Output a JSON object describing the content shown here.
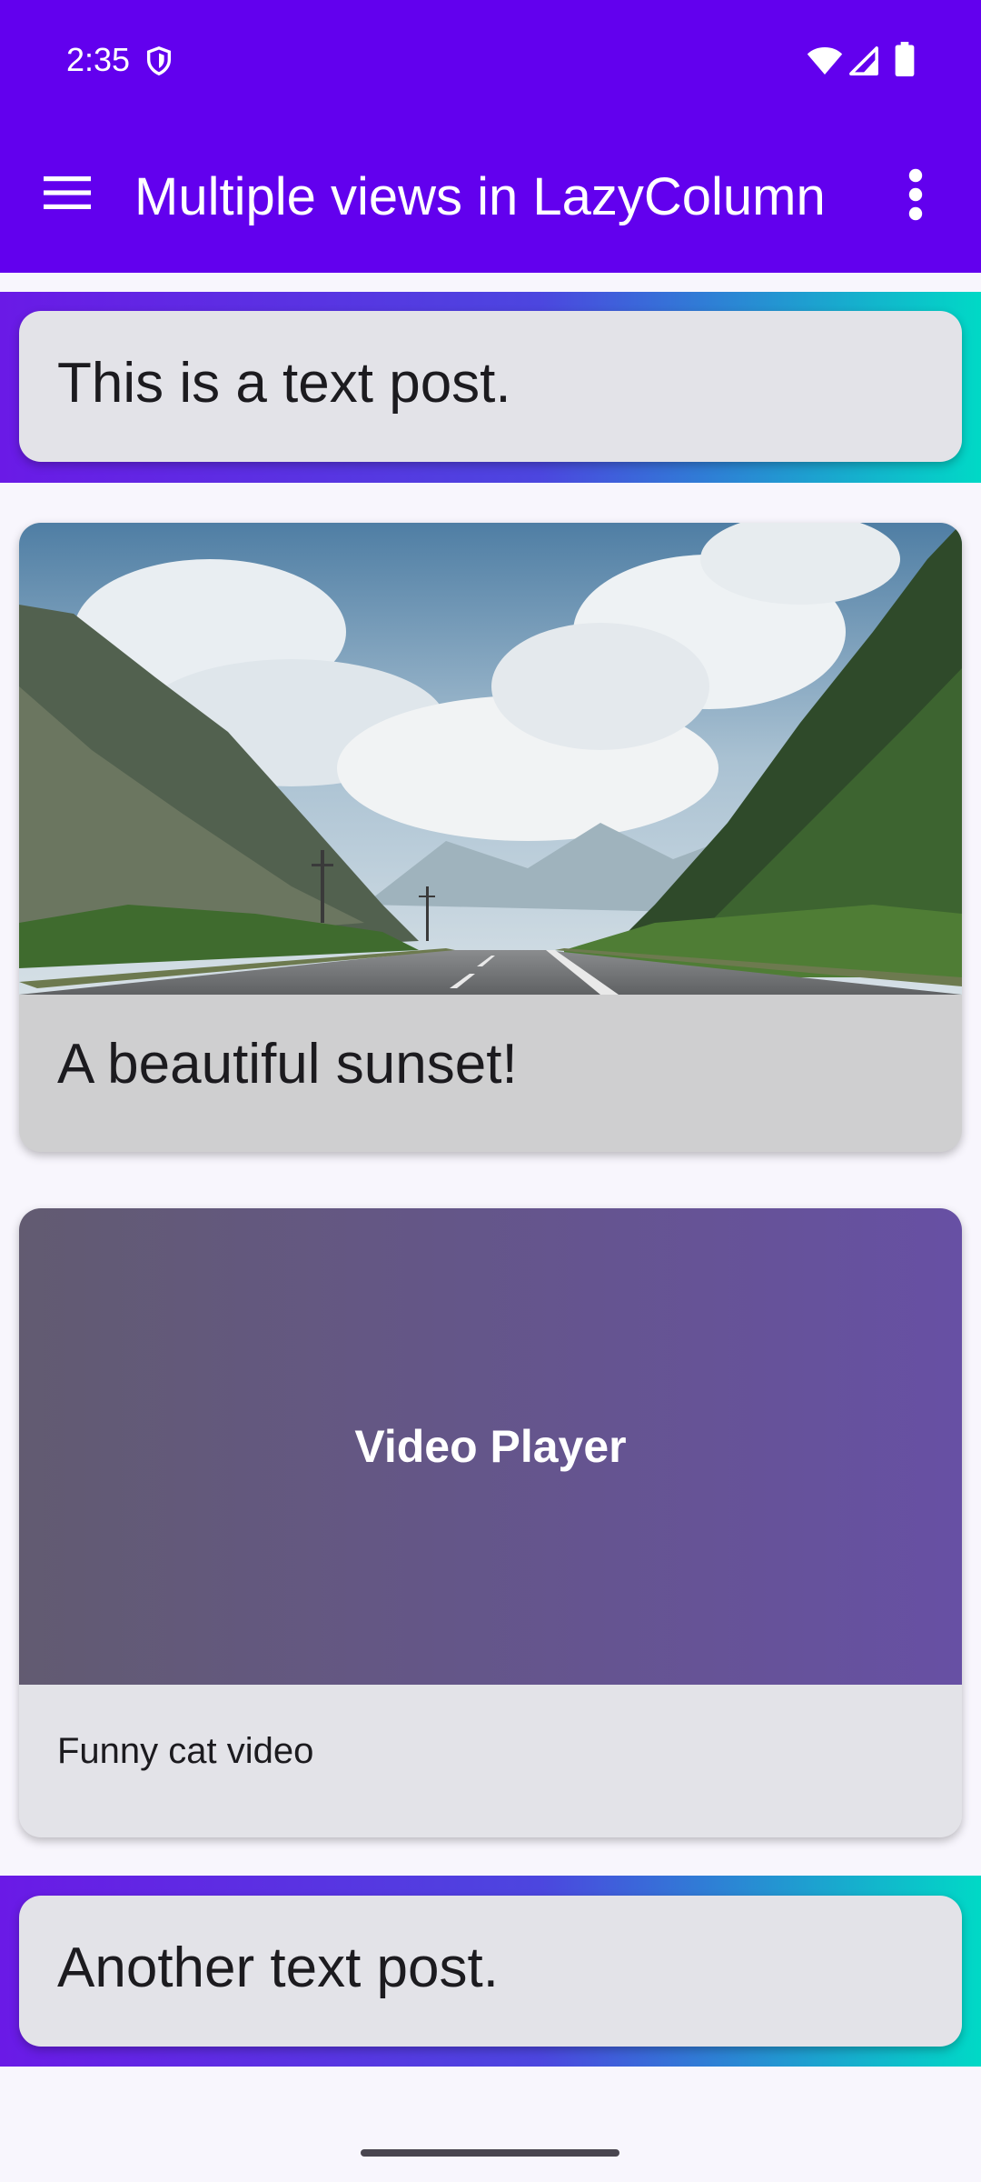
{
  "status_bar": {
    "time": "2:35",
    "icons": [
      "shield-icon",
      "wifi-icon",
      "cellular-signal-icon",
      "battery-icon"
    ]
  },
  "app_bar": {
    "title": "Multiple views in LazyColumn",
    "nav_icon": "menu-icon",
    "action_icon": "more-vert-icon",
    "color": "#6200ee"
  },
  "posts": [
    {
      "type": "text",
      "text": "This is a text post."
    },
    {
      "type": "image",
      "caption": "A beautiful sunset!",
      "image": "mountain-road-landscape"
    },
    {
      "type": "video",
      "player_label": "Video Player",
      "caption": "Funny cat video"
    },
    {
      "type": "text",
      "text": "Another text post."
    }
  ],
  "colors": {
    "accent": "#6200ee",
    "gradient_start": "#6a1ae6",
    "gradient_end": "#00d9c6",
    "card_background": "#e3e3e8",
    "video_start": "#625b71",
    "video_end": "#6750a4"
  }
}
